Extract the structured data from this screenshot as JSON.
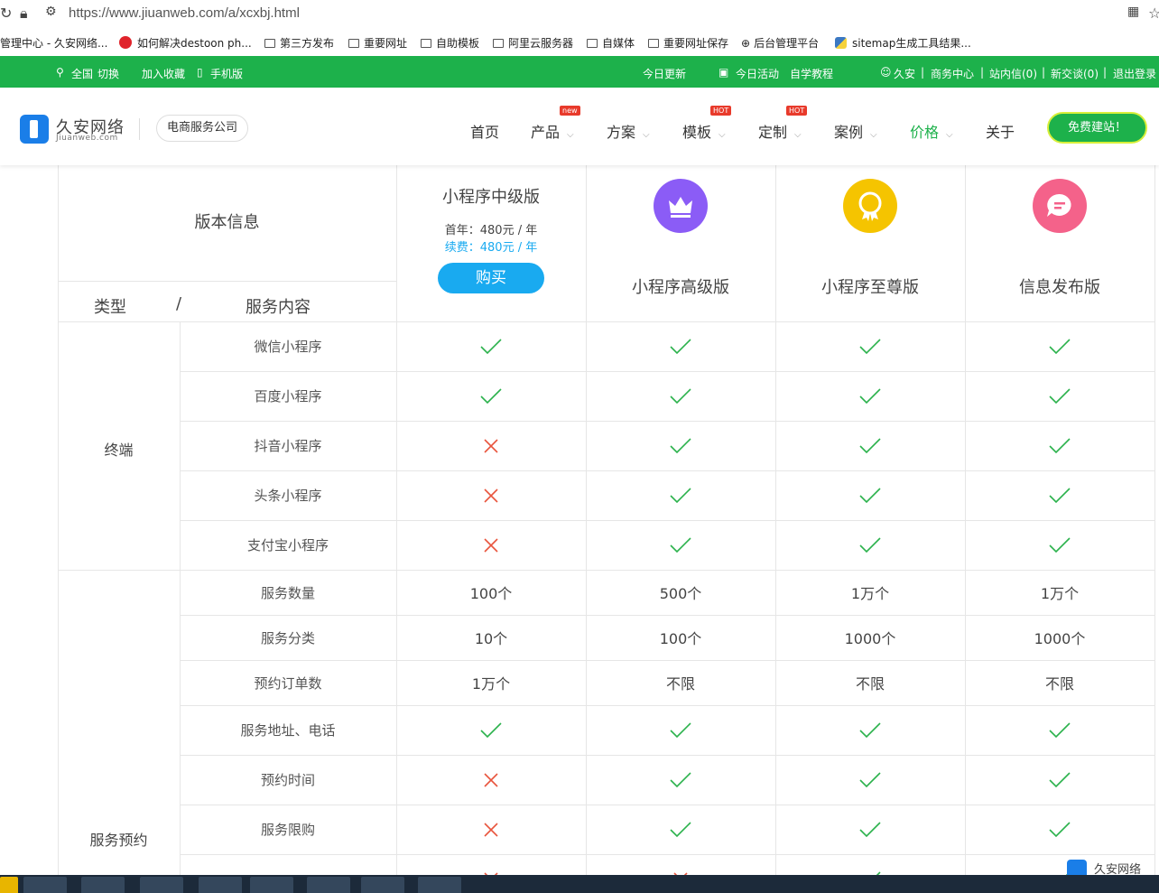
{
  "browser": {
    "url": "https://www.jiuanweb.com/a/xcxbj.html",
    "bookmarks": [
      "管理中心 - 久安网络...",
      "如何解决destoon ph...",
      "第三方发布",
      "重要网址",
      "自助模板",
      "阿里云服务器",
      "自媒体",
      "重要网址保存",
      "后台管理平台",
      "sitemap生成工具结果..."
    ]
  },
  "topbar": {
    "region": "全国",
    "switch": "切换",
    "favorite": "加入收藏",
    "mobile": "手机版",
    "today_update": "今日更新",
    "today_activity": "今日活动",
    "self_study": "自学教程",
    "user": "久安",
    "business_center": "商务中心",
    "inbox": "站内信(0)",
    "new_talk": "新交谈(0)",
    "logout": "退出登录"
  },
  "header": {
    "logo_cn": "久安网络",
    "logo_en": "Jiuanweb.com",
    "company": "电商服务公司",
    "nav": [
      "首页",
      "产品",
      "方案",
      "模板",
      "定制",
      "案例",
      "价格",
      "关于"
    ],
    "badges": {
      "product": "new",
      "template": "HOT",
      "custom": "HOT"
    },
    "cta": "免费建站！"
  },
  "table": {
    "version_info": "版本信息",
    "type_label": "类型",
    "slash": "/",
    "service_label": "服务内容",
    "plans": [
      {
        "name": "小程序中级版",
        "first_year": "首年：480元 / 年",
        "renew": "续费：480元 / 年",
        "buy": "购买"
      },
      {
        "name": "小程序高级版",
        "icon": "crown-icon",
        "color": "#8b5cf6"
      },
      {
        "name": "小程序至尊版",
        "icon": "medal-icon",
        "color": "#f5c400"
      },
      {
        "name": "信息发布版",
        "icon": "message-icon",
        "color": "#f4628a"
      }
    ],
    "groups": [
      {
        "label": "终端"
      },
      {
        "label": "服务预约"
      }
    ],
    "rows": [
      {
        "service": "微信小程序",
        "values": [
          "check",
          "check",
          "check",
          "check"
        ]
      },
      {
        "service": "百度小程序",
        "values": [
          "check",
          "check",
          "check",
          "check"
        ]
      },
      {
        "service": "抖音小程序",
        "values": [
          "cross",
          "check",
          "check",
          "check"
        ]
      },
      {
        "service": "头条小程序",
        "values": [
          "cross",
          "check",
          "check",
          "check"
        ]
      },
      {
        "service": "支付宝小程序",
        "values": [
          "cross",
          "check",
          "check",
          "check"
        ]
      },
      {
        "service": "服务数量",
        "values": [
          "100个",
          "500个",
          "1万个",
          "1万个"
        ]
      },
      {
        "service": "服务分类",
        "values": [
          "10个",
          "100个",
          "1000个",
          "1000个"
        ]
      },
      {
        "service": "预约订单数",
        "values": [
          "1万个",
          "不限",
          "不限",
          "不限"
        ]
      },
      {
        "service": "服务地址、电话",
        "values": [
          "check",
          "check",
          "check",
          "check"
        ]
      },
      {
        "service": "预约时间",
        "values": [
          "cross",
          "check",
          "check",
          "check"
        ]
      },
      {
        "service": "服务限购",
        "values": [
          "cross",
          "check",
          "check",
          "check"
        ]
      },
      {
        "service": "",
        "values": [
          "cross",
          "cross",
          "check",
          "check"
        ]
      }
    ]
  },
  "floating_logo": "久安网络",
  "colors": {
    "green": "#1db14b",
    "blue": "#19aaf0",
    "check": "#2bb24c",
    "cross": "#e8553e"
  }
}
